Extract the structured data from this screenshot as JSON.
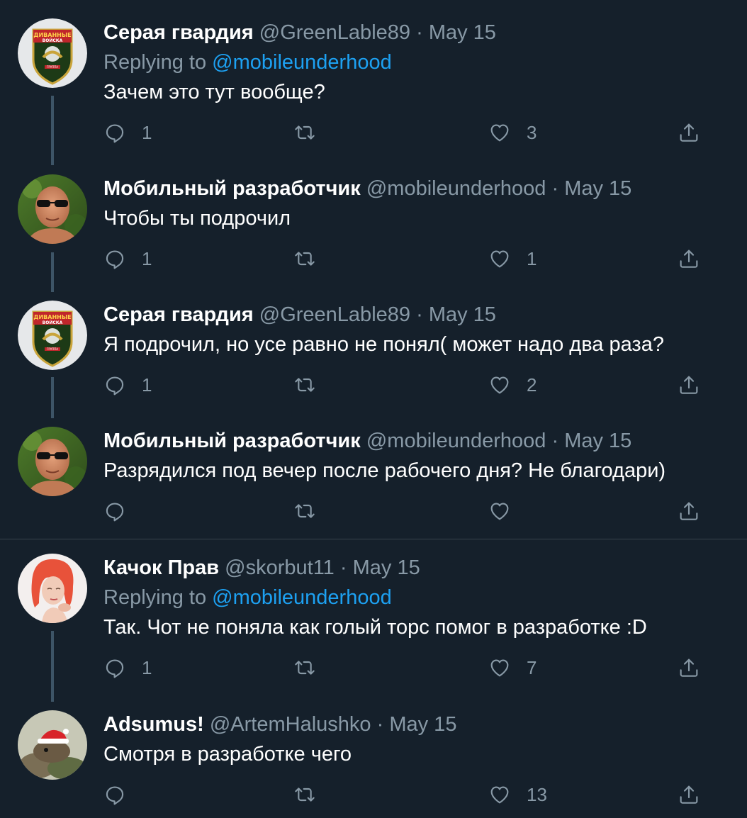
{
  "colors": {
    "background": "#15202b",
    "name": "#ffffff",
    "muted": "#8899a6",
    "link": "#1da1f2",
    "thread_line": "#3d5466"
  },
  "tweets": [
    {
      "name": "Серая гвардия",
      "handle": "@GreenLable89",
      "dot": "·",
      "date": "May 15",
      "replying_prefix": "Replying to",
      "replying_to": "@mobileunderhood",
      "text": "Зачем это тут вообще?",
      "replies": "1",
      "retweets": "",
      "likes": "3",
      "avatar": "badge-logo",
      "avatar_badge_lines": [
        "ДИВАННЫЕ",
        "ВОЙСКА",
        "ГРУППА"
      ]
    },
    {
      "name": "Мобильный разработчик",
      "handle": "@mobileunderhood",
      "dot": "·",
      "date": "May 15",
      "text": "Чтобы ты подрочил",
      "replies": "1",
      "retweets": "",
      "likes": "1",
      "avatar": "man-sunglasses-photo"
    },
    {
      "name": "Серая гвардия",
      "handle": "@GreenLable89",
      "dot": "·",
      "date": "May 15",
      "text": "Я подрочил, но усе равно не понял( может надо два раза?",
      "replies": "1",
      "retweets": "",
      "likes": "2",
      "avatar": "badge-logo",
      "avatar_badge_lines": [
        "ДИВАННЫЕ",
        "ВОЙСКА",
        "ГРУППА"
      ]
    },
    {
      "name": "Мобильный разработчик",
      "handle": "@mobileunderhood",
      "dot": "·",
      "date": "May 15",
      "text": "Разрядился под вечер после рабочего дня? Не благодари)",
      "replies": "",
      "retweets": "",
      "likes": "",
      "avatar": "man-sunglasses-photo"
    },
    {
      "name": "Качок Прав",
      "handle": "@skorbut11",
      "dot": "·",
      "date": "May 15",
      "replying_prefix": "Replying to",
      "replying_to": "@mobileunderhood",
      "text": "Так. Чот не поняла как голый торс помог в разработке :D",
      "replies": "1",
      "retweets": "",
      "likes": "7",
      "avatar": "red-haired-woman-photo"
    },
    {
      "name": "Adsumus!",
      "handle": "@ArtemHalushko",
      "dot": "·",
      "date": "May 15",
      "text": "Смотря в разработке чего",
      "replies": "",
      "retweets": "",
      "likes": "13",
      "avatar": "animal-santa-hat-photo"
    }
  ],
  "icons": {
    "reply": "reply-icon",
    "retweet": "retweet-icon",
    "like": "like-icon",
    "share": "share-icon"
  }
}
